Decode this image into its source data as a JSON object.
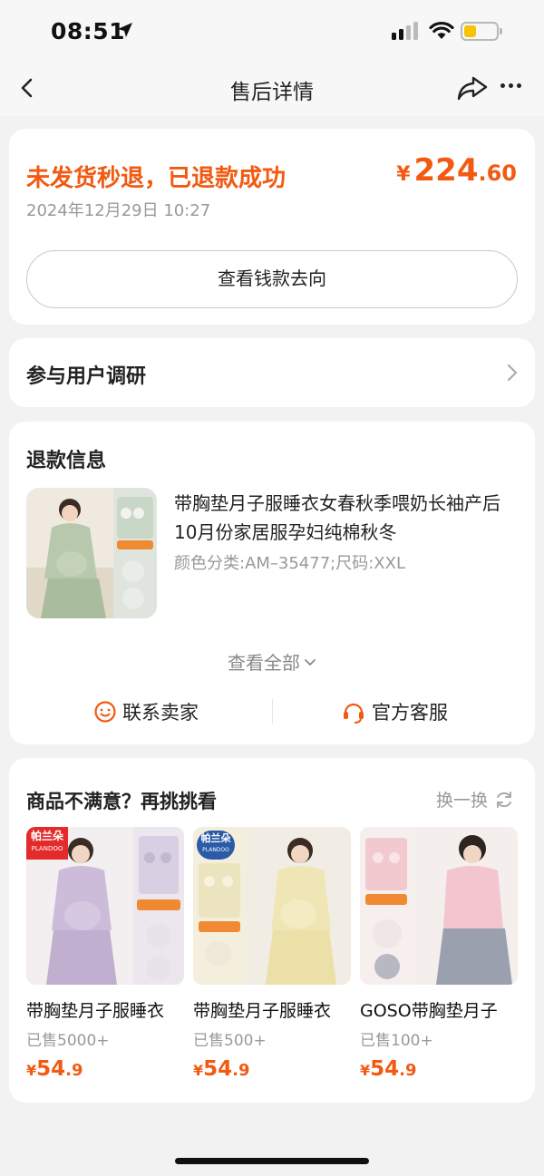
{
  "status_bar": {
    "time": "08:51"
  },
  "nav": {
    "title": "售后详情"
  },
  "refund": {
    "status": "未发货秒退，已退款成功",
    "time": "2024年12月29日 10:27",
    "currency": "¥",
    "amount_int": "224",
    "amount_dec": ".60",
    "money_button": "查看钱款去向"
  },
  "survey": {
    "label": "参与用户调研"
  },
  "refund_info": {
    "title": "退款信息",
    "product_name": "带胸垫月子服睡衣女春秋季喂奶长袖产后10月份家居服孕妇纯棉秋冬",
    "product_spec": "颜色分类:AM–35477;尺码:XXL",
    "view_all": "查看全部",
    "contact_seller": "联系卖家",
    "official_service": "官方客服"
  },
  "recommend": {
    "title": "商品不满意？再挑挑看",
    "refresh": "换一换",
    "items": [
      {
        "name": "带胸垫月子服睡衣",
        "sold": "已售5000+",
        "cur": "¥",
        "price_int": "54",
        "price_dec": ".9",
        "brand": "帕兰朵",
        "brand_en": "PLANDOO"
      },
      {
        "name": "带胸垫月子服睡衣",
        "sold": "已售500+",
        "cur": "¥",
        "price_int": "54",
        "price_dec": ".9",
        "brand": "帕兰朵",
        "brand_en": "PLANDOO"
      },
      {
        "name": "GOSO带胸垫月子",
        "sold": "已售100+",
        "cur": "¥",
        "price_int": "54",
        "price_dec": ".9"
      }
    ]
  },
  "colors": {
    "accent": "#f25a12",
    "background": "#f2f2f2",
    "card": "#ffffff"
  }
}
